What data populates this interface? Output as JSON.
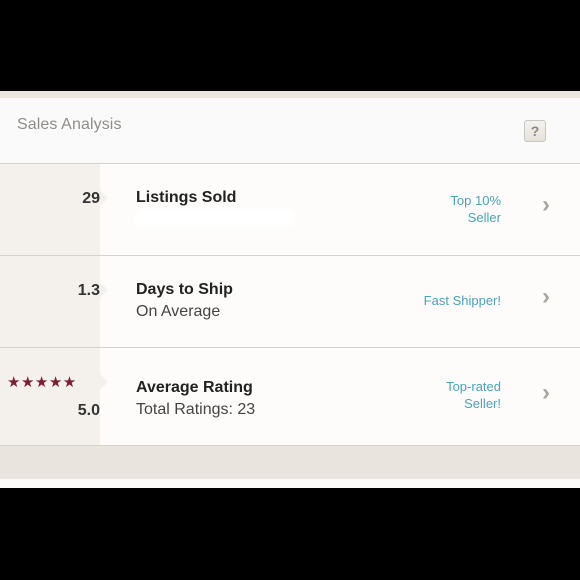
{
  "panel": {
    "title": "Sales Analysis",
    "help_icon": "question-icon",
    "help_label": "?"
  },
  "rows": [
    {
      "metric": "29",
      "title": "Listings Sold",
      "subtitle": "",
      "badge_line1": "Top 10%",
      "badge_line2": "Seller"
    },
    {
      "metric": "1.3",
      "title": "Days to Ship",
      "subtitle": "On Average",
      "badge_line1": "Fast Shipper!",
      "badge_line2": ""
    },
    {
      "metric": "5.0",
      "stars": "★★★★★",
      "star_count": 5,
      "title": "Average Rating",
      "subtitle": "Total Ratings: 23",
      "badge_line1": "Top-rated",
      "badge_line2": "Seller!"
    }
  ],
  "icons": {
    "chevron": "chevron-right-icon",
    "star": "star-icon"
  },
  "colors": {
    "badge": "#4aa3b8",
    "star": "#7b2030",
    "left_column": "#f4f1ed"
  }
}
